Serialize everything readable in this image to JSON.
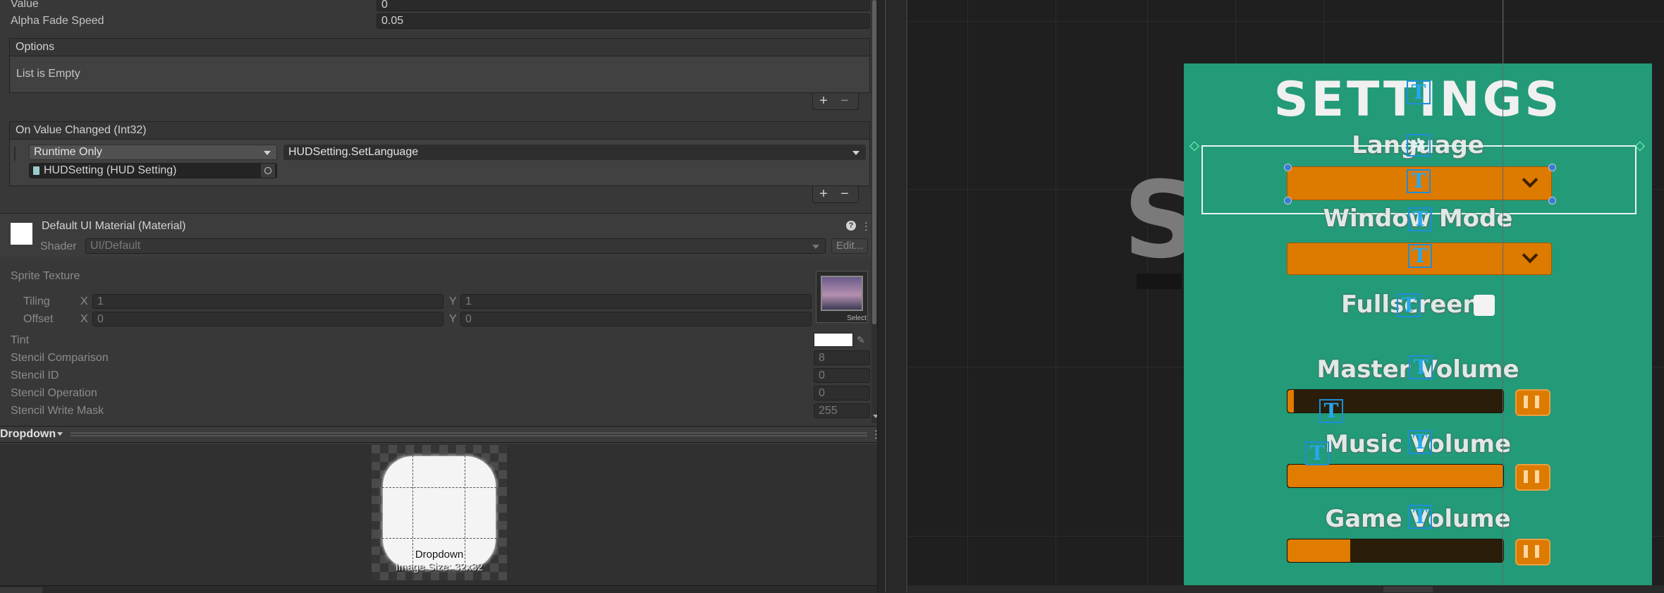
{
  "inspector": {
    "value_label": "Value",
    "value": "0",
    "alpha_label": "Alpha Fade Speed",
    "alpha_value": "0.05",
    "options_header": "Options",
    "options_empty": "List is Empty",
    "plus": "+",
    "minus": "−",
    "event_header": "On Value Changed (Int32)",
    "runtime_option": "Runtime Only",
    "function_name": "HUDSetting.SetLanguage",
    "target_object": "HUDSetting (HUD Setting)",
    "material_name": "Default UI Material (Material)",
    "shader_label": "Shader",
    "shader_value": "UI/Default",
    "edit_button": "Edit...",
    "sprite_texture_label": "Sprite Texture",
    "tiling_label": "Tiling",
    "offset_label": "Offset",
    "x_label": "X",
    "y_label": "Y",
    "tiling_x": "1",
    "tiling_y": "1",
    "offset_x": "0",
    "offset_y": "0",
    "texture_thumb_caption": "Select",
    "tint_label": "Tint",
    "stencil_comparison_label": "Stencil Comparison",
    "stencil_comparison": "8",
    "stencil_id_label": "Stencil ID",
    "stencil_id": "0",
    "stencil_operation_label": "Stencil Operation",
    "stencil_operation": "0",
    "stencil_write_mask_label": "Stencil Write Mask",
    "stencil_write_mask": "255"
  },
  "preview": {
    "dropdown_label": "Dropdown",
    "sprite_name": "Dropdown",
    "image_size": "Image Size: 32x32"
  },
  "scene": {
    "title": "SETTINGS",
    "language_label": "Language",
    "window_mode_label": "Window Mode",
    "fullscreen_label": "Fullscreen",
    "master_volume_label": "Master Volume",
    "music_volume_label": "Music Volume",
    "game_volume_label": "Game Volume",
    "bg_letter": "S",
    "master_volume": 0.03,
    "music_volume": 1.0,
    "game_volume": 0.29,
    "colors": {
      "panel": "#239a78",
      "accent": "#dd7a00",
      "gizmo": "#1e8ed8"
    }
  }
}
